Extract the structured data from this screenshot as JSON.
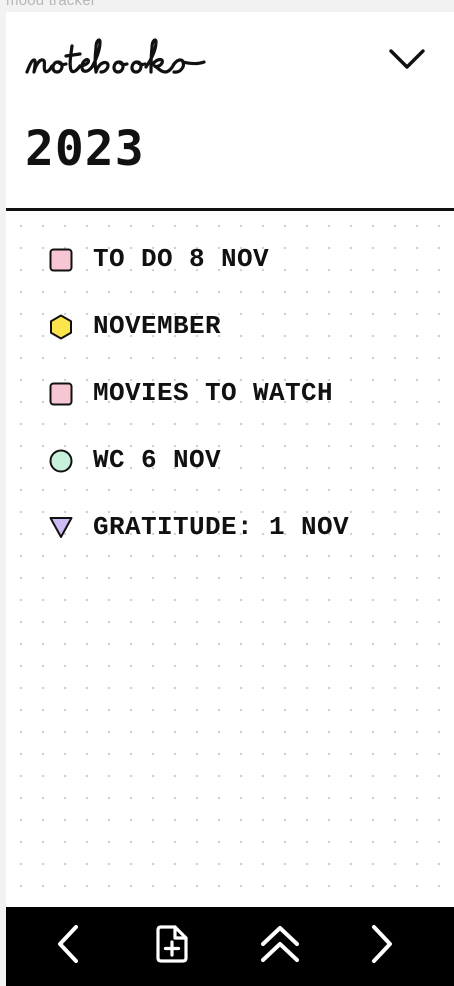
{
  "app": {
    "title_caption": "mood tracker",
    "brand_logo_text": "notebooks"
  },
  "header": {
    "year": "2023",
    "dropdown_icon": "chevron-down-icon"
  },
  "notebooks": [
    {
      "label": "TO DO 8 NOV",
      "shape": "square",
      "color": "#f7c6d3"
    },
    {
      "label": "NOVEMBER",
      "shape": "hexagon",
      "color": "#fbe54a"
    },
    {
      "label": "MOVIES TO WATCH",
      "shape": "square",
      "color": "#f7c6d3"
    },
    {
      "label": "WC 6 NOV",
      "shape": "circle",
      "color": "#c7f1dd"
    },
    {
      "label": "GRATITUDE: 1 NOV",
      "shape": "triangle",
      "color": "#cdbcf3"
    }
  ],
  "bottom_nav": {
    "items": [
      {
        "icon": "chevron-left-icon"
      },
      {
        "icon": "new-page-icon"
      },
      {
        "icon": "double-chevron-up-icon"
      },
      {
        "icon": "chevron-right-icon"
      }
    ]
  },
  "colors": {
    "accent_black": "#111111",
    "bottom_bar": "#000000",
    "dot_grid": "#d0d0d0",
    "background": "#ffffff"
  }
}
